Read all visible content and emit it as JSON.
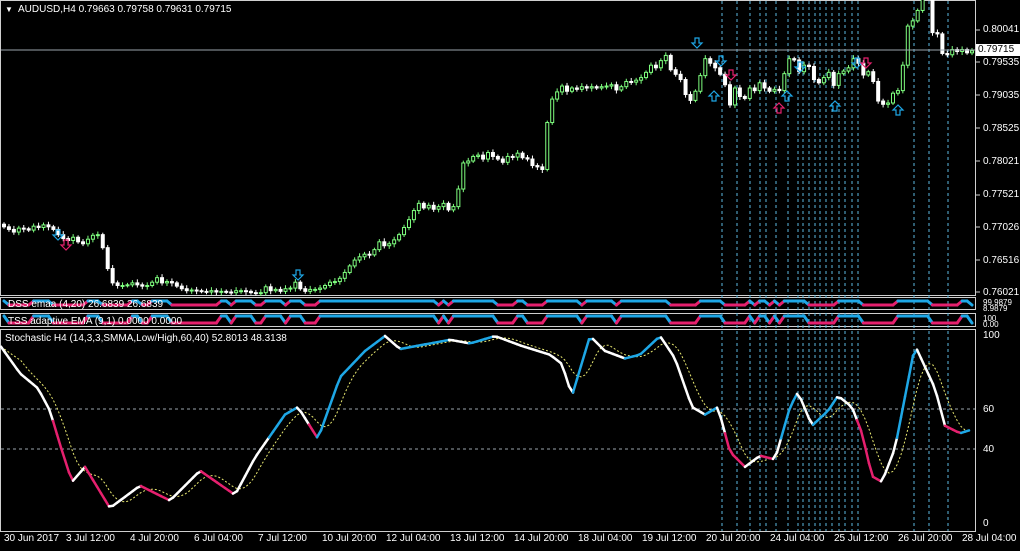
{
  "main_panel": {
    "symbol_header": "AUDUSD,H4  0.79663 0.79758 0.79631 0.79715",
    "price_axis": [
      "0.80041",
      "0.79535",
      "0.79035",
      "0.78525",
      "0.78021",
      "0.77521",
      "0.77026",
      "0.76516",
      "0.76021"
    ],
    "current_price": "0.79715"
  },
  "dss_panel": {
    "label": "DSS emaa (4,20) 26.6839 26.6839",
    "axis": [
      "99.9879",
      "8.9879"
    ]
  },
  "tss_panel": {
    "label": "TSS adaptive EMA (9,1) 0.0000 0.0000",
    "axis": [
      "100",
      "0.00"
    ]
  },
  "stoch_panel": {
    "label": "Stochastic H4 (14,3,3,SMMA,Low/High,60,40) 52.8013 48.3138",
    "axis": [
      "100",
      "60",
      "40",
      "0"
    ]
  },
  "time_axis": [
    "30 Jun 2017",
    "3 Jul 12:00",
    "4 Jul 20:00",
    "6 Jul 04:00",
    "7 Jul 12:00",
    "10 Jul 20:00",
    "12 Jul 04:00",
    "13 Jul 12:00",
    "14 Jul 20:00",
    "18 Jul 04:00",
    "19 Jul 12:00",
    "20 Jul 20:00",
    "24 Jul 04:00",
    "25 Jul 12:00",
    "26 Jul 20:00",
    "28 Jul 04:00"
  ],
  "colors": {
    "bull": "#7fff7f",
    "bear": "#ffffff",
    "up_arrow": "#1ea7e6",
    "down_arrow": "#e6206e",
    "stoch_up": "#1ea7e6",
    "stoch_down": "#e6206e",
    "grid": "#9aa4ad"
  },
  "chart_data": {
    "type": "candlestick",
    "closes": [
      0.7702,
      0.7698,
      0.7694,
      0.77,
      0.7699,
      0.7697,
      0.7703,
      0.7701,
      0.7705,
      0.7702,
      0.7698,
      0.769,
      0.7684,
      0.7681,
      0.7686,
      0.7679,
      0.7676,
      0.7683,
      0.7689,
      0.769,
      0.767,
      0.7638,
      0.7616,
      0.7612,
      0.7612,
      0.7613,
      0.7616,
      0.7613,
      0.7611,
      0.7612,
      0.7617,
      0.7624,
      0.7616,
      0.7618,
      0.7616,
      0.7611,
      0.7607,
      0.7604,
      0.7605,
      0.7604,
      0.7603,
      0.7602,
      0.7604,
      0.7602,
      0.7603,
      0.7602,
      0.7601,
      0.7604,
      0.7604,
      0.7603,
      0.7601,
      0.76,
      0.7601,
      0.761,
      0.7604,
      0.7606,
      0.7603,
      0.7607,
      0.7608,
      0.7617,
      0.7607,
      0.7603,
      0.7606,
      0.7606,
      0.7608,
      0.7612,
      0.7617,
      0.7618,
      0.7623,
      0.7632,
      0.7642,
      0.7651,
      0.7656,
      0.766,
      0.7659,
      0.7667,
      0.7679,
      0.7673,
      0.7676,
      0.7682,
      0.769,
      0.7701,
      0.7713,
      0.7727,
      0.7738,
      0.7731,
      0.7735,
      0.7729,
      0.7733,
      0.7738,
      0.7728,
      0.7733,
      0.776,
      0.78,
      0.7803,
      0.781,
      0.7812,
      0.7806,
      0.7816,
      0.781,
      0.7806,
      0.7801,
      0.781,
      0.7809,
      0.7815,
      0.7808,
      0.7806,
      0.7796,
      0.7794,
      0.779,
      0.7862,
      0.7898,
      0.7909,
      0.7918,
      0.791,
      0.7915,
      0.7913,
      0.7917,
      0.7915,
      0.7917,
      0.7915,
      0.7917,
      0.7918,
      0.792,
      0.7912,
      0.7917,
      0.7925,
      0.7924,
      0.7927,
      0.7931,
      0.7939,
      0.795,
      0.7946,
      0.7957,
      0.7965,
      0.7943,
      0.7936,
      0.7928,
      0.7905,
      0.7896,
      0.791,
      0.7934,
      0.796,
      0.7953,
      0.7946,
      0.7936,
      0.792,
      0.7889,
      0.7915,
      0.7902,
      0.7899,
      0.7915,
      0.7911,
      0.7923,
      0.7915,
      0.791,
      0.7913,
      0.7911,
      0.7937,
      0.796,
      0.7958,
      0.794,
      0.795,
      0.7948,
      0.7928,
      0.7923,
      0.7931,
      0.7939,
      0.7919,
      0.7937,
      0.7941,
      0.7946,
      0.796,
      0.7953,
      0.7935,
      0.794,
      0.7925,
      0.7895,
      0.789,
      0.7892,
      0.7907,
      0.7911,
      0.795,
      0.801,
      0.8018,
      0.8034,
      0.8069,
      0.806,
      0.8,
      0.7998,
      0.7968,
      0.7966,
      0.7974,
      0.7971,
      0.7974,
      0.7969,
      0.7972
    ]
  }
}
